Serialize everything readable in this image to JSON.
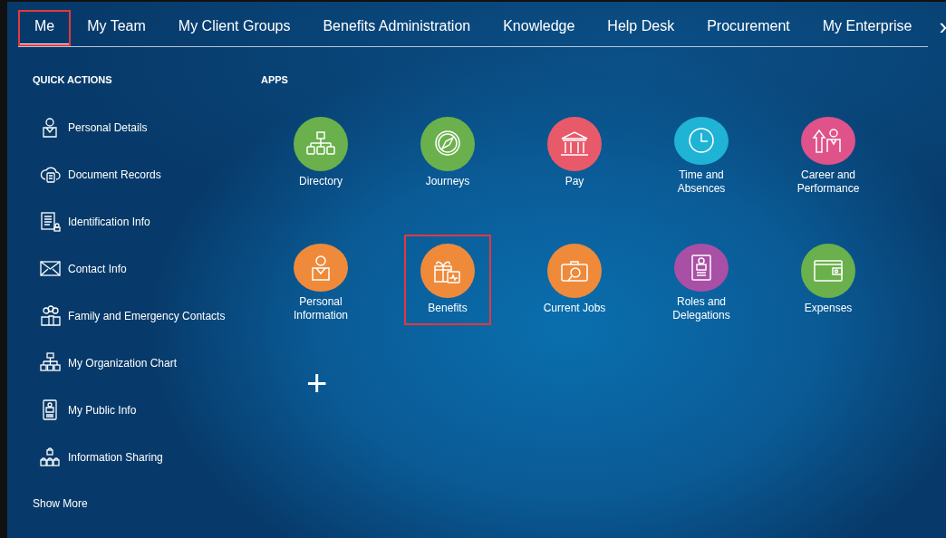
{
  "tabs": [
    {
      "label": "Me",
      "selected": true,
      "highlighted": true
    },
    {
      "label": "My Team",
      "selected": false,
      "highlighted": false
    },
    {
      "label": "My Client Groups",
      "selected": false,
      "highlighted": false
    },
    {
      "label": "Benefits Administration",
      "selected": false,
      "highlighted": false
    },
    {
      "label": "Knowledge",
      "selected": false,
      "highlighted": false
    },
    {
      "label": "Help Desk",
      "selected": false,
      "highlighted": false
    },
    {
      "label": "Procurement",
      "selected": false,
      "highlighted": false
    },
    {
      "label": "My Enterprise",
      "selected": false,
      "highlighted": false
    }
  ],
  "tabs_next": "›",
  "quick_actions": {
    "heading": "QUICK ACTIONS",
    "items": [
      {
        "label": "Personal Details"
      },
      {
        "label": "Document Records"
      },
      {
        "label": "Identification Info"
      },
      {
        "label": "Contact Info"
      },
      {
        "label": "Family and Emergency Contacts"
      },
      {
        "label": "My Organization Chart"
      },
      {
        "label": "My Public Info"
      },
      {
        "label": "Information Sharing"
      }
    ],
    "show_more": "Show More"
  },
  "apps": {
    "heading": "APPS",
    "items": [
      {
        "label": "Directory",
        "color": "#6ab04c",
        "highlighted": false
      },
      {
        "label": "Journeys",
        "color": "#6ab04c",
        "highlighted": false
      },
      {
        "label": "Pay",
        "color": "#e85a6a",
        "highlighted": false
      },
      {
        "label": "Time and Absences",
        "color": "#1fb3d6",
        "highlighted": false
      },
      {
        "label": "Career and Performance",
        "color": "#e0528a",
        "highlighted": false
      },
      {
        "label": "Personal Information",
        "color": "#ef8a3a",
        "highlighted": false
      },
      {
        "label": "Benefits",
        "color": "#ef8a3a",
        "highlighted": true
      },
      {
        "label": "Current Jobs",
        "color": "#ef8a3a",
        "highlighted": false
      },
      {
        "label": "Roles and Delegations",
        "color": "#a94fa5",
        "highlighted": false
      },
      {
        "label": "Expenses",
        "color": "#6ab04c",
        "highlighted": false
      }
    ],
    "add": "+"
  }
}
